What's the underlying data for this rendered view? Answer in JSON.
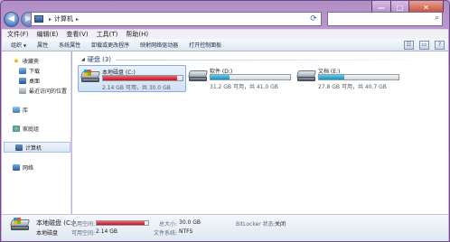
{
  "window": {
    "caption_buttons": {
      "minimize": "—",
      "maximize": "□",
      "close": "✕"
    }
  },
  "address": {
    "separator": "▸",
    "current": "计算机",
    "trailing": "▸"
  },
  "menubar": {
    "items": [
      "文件(F)",
      "编辑(E)",
      "查看(V)",
      "工具(T)",
      "帮助(H)"
    ]
  },
  "commands": {
    "items": [
      "组织",
      "属性",
      "系统属性",
      "卸载或更改程序",
      "映射网络驱动器",
      "打开控制面板"
    ],
    "organize_arrow": "▼"
  },
  "nav_pane": {
    "items": [
      {
        "label": "收藏夹",
        "icon": "star-icon"
      },
      {
        "label": "下载",
        "icon": "folder-icon"
      },
      {
        "label": "桌面",
        "icon": "desktop-icon"
      },
      {
        "label": "最近访问的位置",
        "icon": "recent-icon"
      },
      {
        "label": "库",
        "icon": "library-icon"
      },
      {
        "label": "家庭组",
        "icon": "homegroup-icon"
      },
      {
        "label": "计算机",
        "icon": "computer-icon"
      },
      {
        "label": "网络",
        "icon": "network-icon"
      }
    ]
  },
  "main": {
    "group_title": "硬盘 (3)",
    "drives": [
      {
        "name": "本地磁盘 (C:)",
        "free_text": "2.14 GB 可用，共 30.0 GB",
        "used_fraction": 0.93,
        "bar_color": "#c1121f"
      },
      {
        "name": "软件 (D:)",
        "free_text": "31.2 GB 可用，共 41.0 GB",
        "used_fraction": 0.24,
        "bar_color": "#1a8fc2"
      },
      {
        "name": "文档 (E:)",
        "free_text": "27.8 GB 可用，共 40.7 GB",
        "used_fraction": 0.32,
        "bar_color": "#1a8fc2"
      }
    ]
  },
  "details": {
    "name": "本地磁盘 (C:)",
    "type": "本地磁盘",
    "used_label": "已用空间:",
    "used_fraction": 0.93,
    "free_label": "可用空间:",
    "free_value": "2.14 GB",
    "total_label": "总大小:",
    "total_value": "30.0 GB",
    "fs_label": "文件系统:",
    "fs_value": "NTFS",
    "bitlocker_label": "BitLocker 状态:",
    "bitlocker_value": "关闭"
  }
}
